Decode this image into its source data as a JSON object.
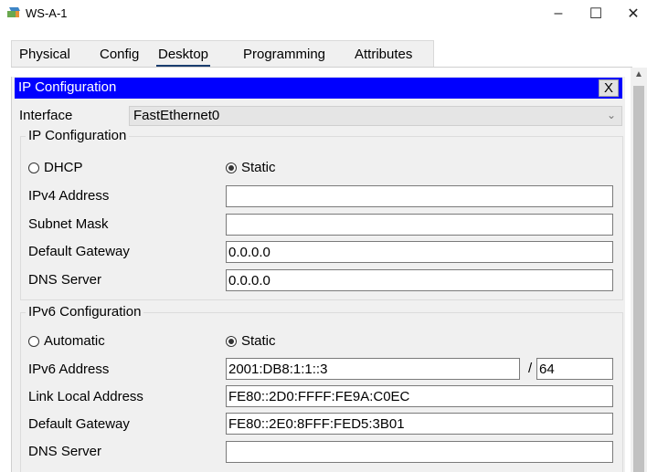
{
  "window": {
    "title": "WS-A-1",
    "minimize_glyph": "–",
    "maximize_glyph": "☐",
    "close_glyph": "✕"
  },
  "tabs": [
    {
      "label": "Physical",
      "active": false
    },
    {
      "label": "Config",
      "active": false
    },
    {
      "label": "Desktop",
      "active": true
    },
    {
      "label": "Programming",
      "active": false
    },
    {
      "label": "Attributes",
      "active": false
    }
  ],
  "panel": {
    "title": "IP Configuration",
    "close_label": "X",
    "interface_label": "Interface",
    "interface_value": "FastEthernet0"
  },
  "ipv4": {
    "legend": "IP Configuration",
    "dhcp_label": "DHCP",
    "static_label": "Static",
    "mode": "static",
    "address_label": "IPv4 Address",
    "address_value": "",
    "mask_label": "Subnet Mask",
    "mask_value": "",
    "gateway_label": "Default Gateway",
    "gateway_value": "0.0.0.0",
    "dns_label": "DNS Server",
    "dns_value": "0.0.0.0"
  },
  "ipv6": {
    "legend": "IPv6 Configuration",
    "auto_label": "Automatic",
    "static_label": "Static",
    "mode": "static",
    "address_label": "IPv6 Address",
    "address_value": "2001:DB8:1:1::3",
    "prefix_separator": "/",
    "prefix_value": "64",
    "link_local_label": "Link Local Address",
    "link_local_value": "FE80::2D0:FFFF:FE9A:C0EC",
    "gateway_label": "Default Gateway",
    "gateway_value": "FE80::2E0:8FFF:FED5:3B01",
    "dns_label": "DNS Server",
    "dns_value": ""
  },
  "colors": {
    "header_blue": "#0000ff",
    "tab_underline": "#1a3d6e",
    "panel_bg": "#f0f0f0"
  }
}
